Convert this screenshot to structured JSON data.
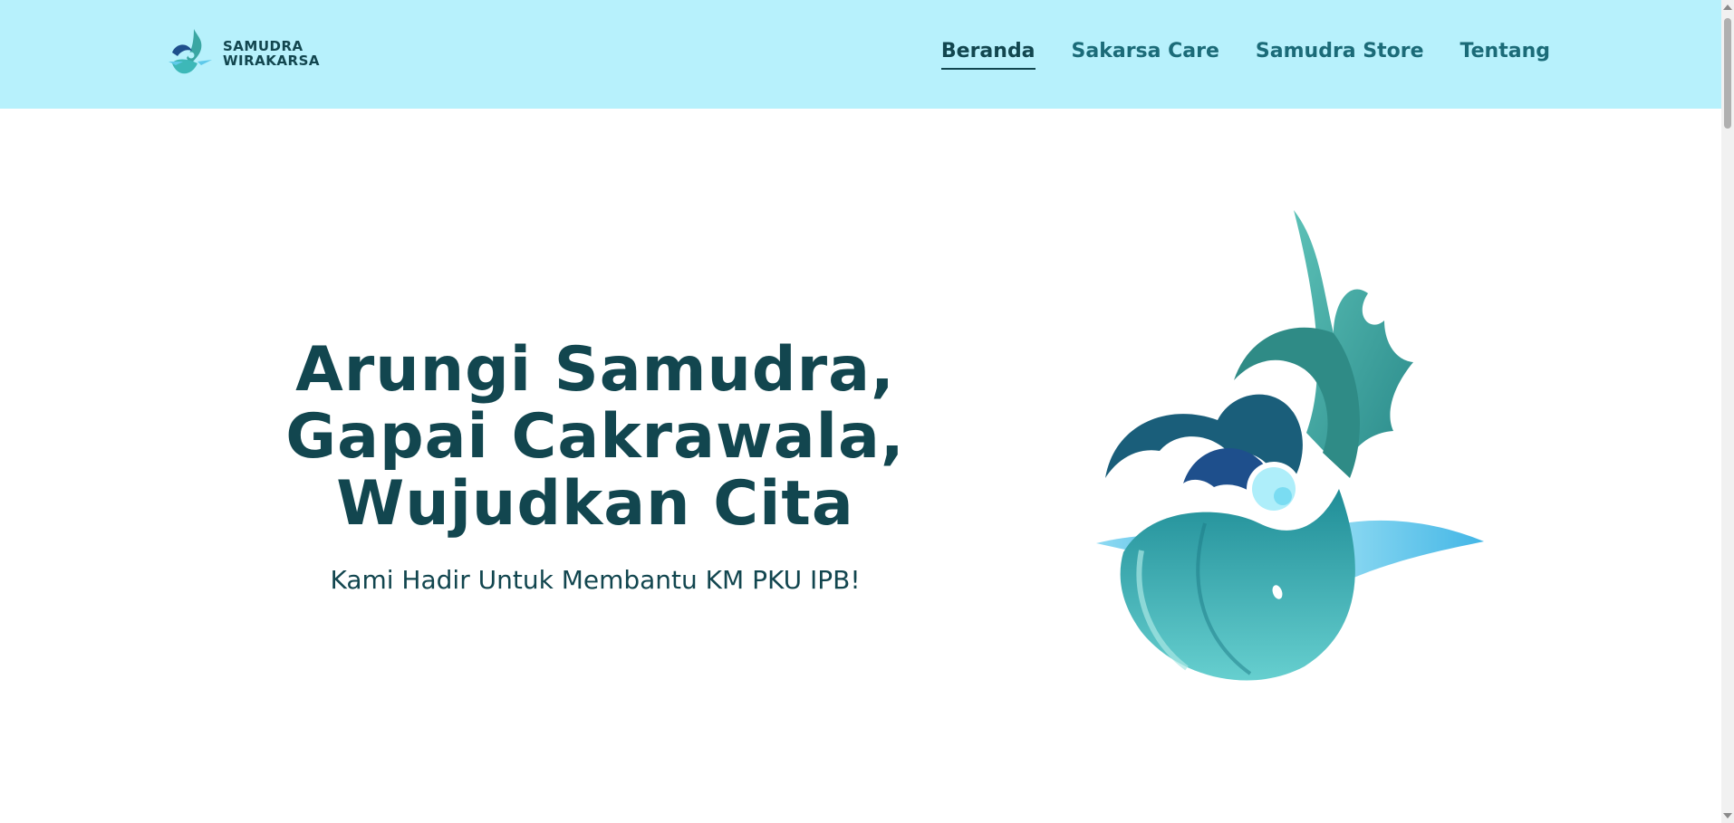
{
  "brand": {
    "line1": "SAMUDRA",
    "line2": "WIRAKARSA"
  },
  "nav": {
    "items": [
      {
        "label": "Beranda",
        "active": true
      },
      {
        "label": "Sakarsa Care",
        "active": false
      },
      {
        "label": "Samudra Store",
        "active": false
      },
      {
        "label": "Tentang",
        "active": false
      }
    ]
  },
  "hero": {
    "title_line1": "Arungi Samudra,",
    "title_line2": "Gapai Cakrawala,",
    "title_line3": "Wujudkan Cita",
    "subtitle": "Kami Hadir Untuk Membantu KM PKU IPB!"
  },
  "colors": {
    "navbar_bg": "#b7f1fc",
    "text_dark": "#12464f",
    "nav_text": "#1b6b78",
    "teal": "#3aa6a3",
    "blue": "#1e4f8c",
    "light_blue": "#5fc9ea"
  },
  "icons": {
    "brand_logo": "whale-wave-logo-icon",
    "hero_art": "whale-wave-illustration"
  }
}
